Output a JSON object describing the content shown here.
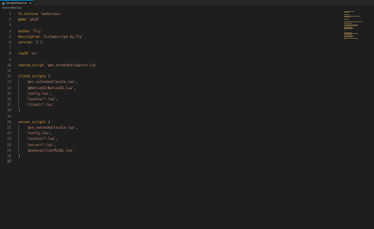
{
  "tab": {
    "label": "fxmanifest.lua",
    "close_glyph": "×",
    "icon": "lua-file-icon"
  },
  "breadcrumb": {
    "file": "fxmanifest.lua"
  },
  "editor": {
    "lines": [
      {
        "n": "1",
        "segs": [
          {
            "t": "fx_version ",
            "c": "kw"
          },
          {
            "t": "'bodacious'",
            "c": "str"
          }
        ]
      },
      {
        "n": "2",
        "segs": [
          {
            "t": "game ",
            "c": "kw"
          },
          {
            "t": "'gta5'",
            "c": "str"
          }
        ]
      },
      {
        "n": "3",
        "segs": []
      },
      {
        "n": "4",
        "segs": [
          {
            "t": "author ",
            "c": "kw"
          },
          {
            "t": "'Fly'",
            "c": "str"
          }
        ]
      },
      {
        "n": "5",
        "segs": [
          {
            "t": "description ",
            "c": "kw"
          },
          {
            "t": "'Customscript by Fly'",
            "c": "str"
          }
        ]
      },
      {
        "n": "6",
        "segs": [
          {
            "t": "version ",
            "c": "kw"
          },
          {
            "t": "'2.1'",
            "c": "str"
          }
        ]
      },
      {
        "n": "7",
        "segs": []
      },
      {
        "n": "8",
        "segs": [
          {
            "t": "lua54 ",
            "c": "kw"
          },
          {
            "t": "'on'",
            "c": "str"
          }
        ]
      },
      {
        "n": "9",
        "segs": []
      },
      {
        "n": "10",
        "segs": [
          {
            "t": "shared_script ",
            "c": "kw"
          },
          {
            "t": "'@es_extended/imports.lua'",
            "c": "str"
          }
        ]
      },
      {
        "n": "11",
        "segs": []
      },
      {
        "n": "12",
        "segs": [
          {
            "t": "client_scripts ",
            "c": "kw"
          },
          {
            "t": "{",
            "c": "pn"
          }
        ]
      },
      {
        "n": "13",
        "segs": [
          {
            "t": "    ",
            "c": "pn"
          },
          {
            "t": "'@es_extended/locale.lua'",
            "c": "str"
          },
          {
            "t": ",",
            "c": "pn"
          }
        ]
      },
      {
        "n": "14",
        "segs": [
          {
            "t": "    ",
            "c": "pn"
          },
          {
            "t": "'@NativeUI/NativeUI.lua'",
            "c": "str"
          },
          {
            "t": ",",
            "c": "pn"
          }
        ]
      },
      {
        "n": "15",
        "segs": [
          {
            "t": "    ",
            "c": "pn"
          },
          {
            "t": "'config.lua'",
            "c": "str"
          },
          {
            "t": ",",
            "c": "pn"
          }
        ]
      },
      {
        "n": "16",
        "segs": [
          {
            "t": "    ",
            "c": "pn"
          },
          {
            "t": "'locales/*.lua'",
            "c": "str"
          },
          {
            "t": ",",
            "c": "pn"
          }
        ]
      },
      {
        "n": "17",
        "segs": [
          {
            "t": "    ",
            "c": "pn"
          },
          {
            "t": "'client/*.lua'",
            "c": "str"
          }
        ]
      },
      {
        "n": "18",
        "segs": [
          {
            "t": "}",
            "c": "pn"
          }
        ]
      },
      {
        "n": "19",
        "segs": []
      },
      {
        "n": "20",
        "segs": [
          {
            "t": "server_scripts ",
            "c": "kw"
          },
          {
            "t": "{",
            "c": "pn"
          }
        ]
      },
      {
        "n": "21",
        "segs": [
          {
            "t": "    ",
            "c": "pn"
          },
          {
            "t": "'@es_extended/locale.lua'",
            "c": "str"
          },
          {
            "t": ",",
            "c": "pn"
          }
        ]
      },
      {
        "n": "22",
        "segs": [
          {
            "t": "    ",
            "c": "pn"
          },
          {
            "t": "'config.lua'",
            "c": "str"
          },
          {
            "t": ",",
            "c": "pn"
          }
        ]
      },
      {
        "n": "23",
        "segs": [
          {
            "t": "    ",
            "c": "pn"
          },
          {
            "t": "'locales/*.lua'",
            "c": "str"
          },
          {
            "t": ",",
            "c": "pn"
          }
        ]
      },
      {
        "n": "24",
        "segs": [
          {
            "t": "    ",
            "c": "pn"
          },
          {
            "t": "'server/*.lua'",
            "c": "str"
          },
          {
            "t": ",",
            "c": "pn"
          }
        ]
      },
      {
        "n": "25",
        "segs": [
          {
            "t": "    ",
            "c": "pn"
          },
          {
            "t": "'@oxmysql/lib/MySQL.lua'",
            "c": "str"
          }
        ]
      },
      {
        "n": "26",
        "segs": [
          {
            "t": "}",
            "c": "pn"
          }
        ]
      },
      {
        "n": "27",
        "segs": []
      }
    ],
    "active_line": "27"
  },
  "colors": {
    "background": "#1e1e1e",
    "keyword": "#e8a23c",
    "string": "#ce9178",
    "line_number": "#858585",
    "tab_accent": "#007acc"
  }
}
